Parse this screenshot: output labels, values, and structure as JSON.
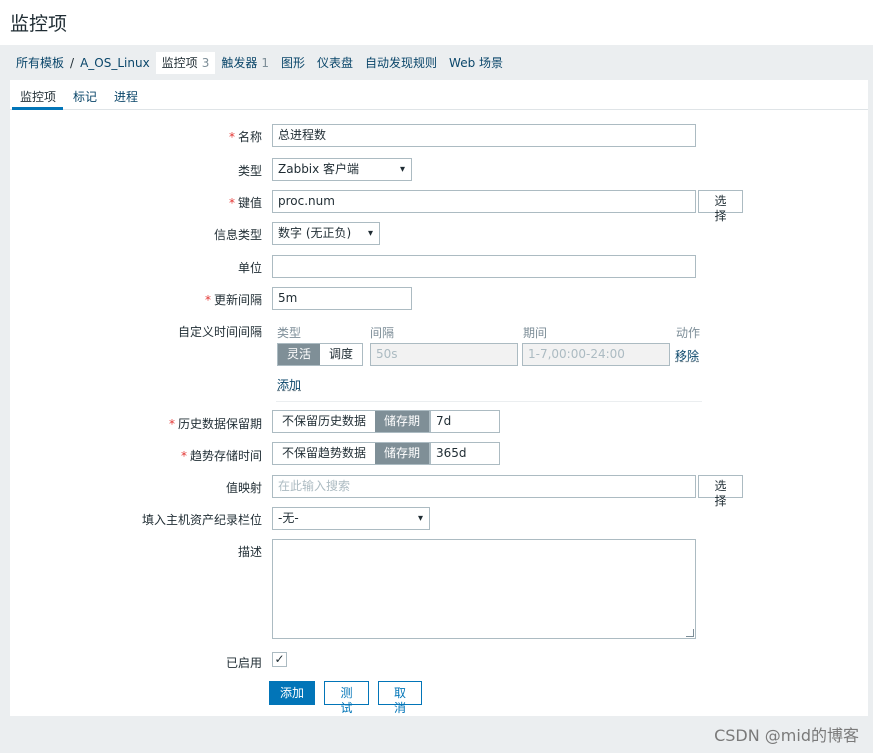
{
  "page": {
    "title": "监控项"
  },
  "breadcrumbs": {
    "all_templates": "所有模板",
    "separator": "/",
    "template": "A_OS_Linux",
    "items": "监控项",
    "items_count": "3",
    "triggers": "触发器",
    "triggers_count": "1",
    "graphs": "图形",
    "dashboards": "仪表盘",
    "discovery": "自动发现规则",
    "web": "Web 场景"
  },
  "tabs": [
    "监控项",
    "标记",
    "进程"
  ],
  "form": {
    "name": {
      "label": "名称",
      "value": "总进程数"
    },
    "type": {
      "label": "类型",
      "value": "Zabbix 客户端"
    },
    "key": {
      "label": "键值",
      "value": "proc.num",
      "button": "选择"
    },
    "info_type": {
      "label": "信息类型",
      "value": "数字 (无正负)"
    },
    "units": {
      "label": "单位",
      "value": ""
    },
    "update_interval": {
      "label": "更新间隔",
      "value": "5m"
    },
    "custom_intervals": {
      "label": "自定义时间间隔",
      "headers": {
        "type": "类型",
        "interval": "间隔",
        "period": "期间",
        "action": "动作"
      },
      "row": {
        "flexible": "灵活",
        "scheduling": "调度",
        "interval": "50s",
        "period": "1-7,00:00-24:00",
        "remove": "移除"
      },
      "add": "添加"
    },
    "history": {
      "label": "历史数据保留期",
      "opt_no_keep": "不保留历史数据",
      "opt_storage": "储存期",
      "value": "7d"
    },
    "trends": {
      "label": "趋势存储时间",
      "opt_no_keep": "不保留趋势数据",
      "opt_storage": "储存期",
      "value": "365d"
    },
    "valuemap": {
      "label": "值映射",
      "placeholder": "在此输入搜索",
      "button": "选择"
    },
    "inventory": {
      "label": "填入主机资产纪录栏位",
      "value": "-无-"
    },
    "description": {
      "label": "描述",
      "value": ""
    },
    "enabled": {
      "label": "已启用",
      "checked": true,
      "mark": "✓"
    }
  },
  "buttons": {
    "add": "添加",
    "test": "测试",
    "cancel": "取消"
  },
  "watermark": "CSDN @mid的博客",
  "colors": {
    "primary": "#0275b8",
    "required": "#e33734",
    "segment_active": "#7f8f97"
  }
}
